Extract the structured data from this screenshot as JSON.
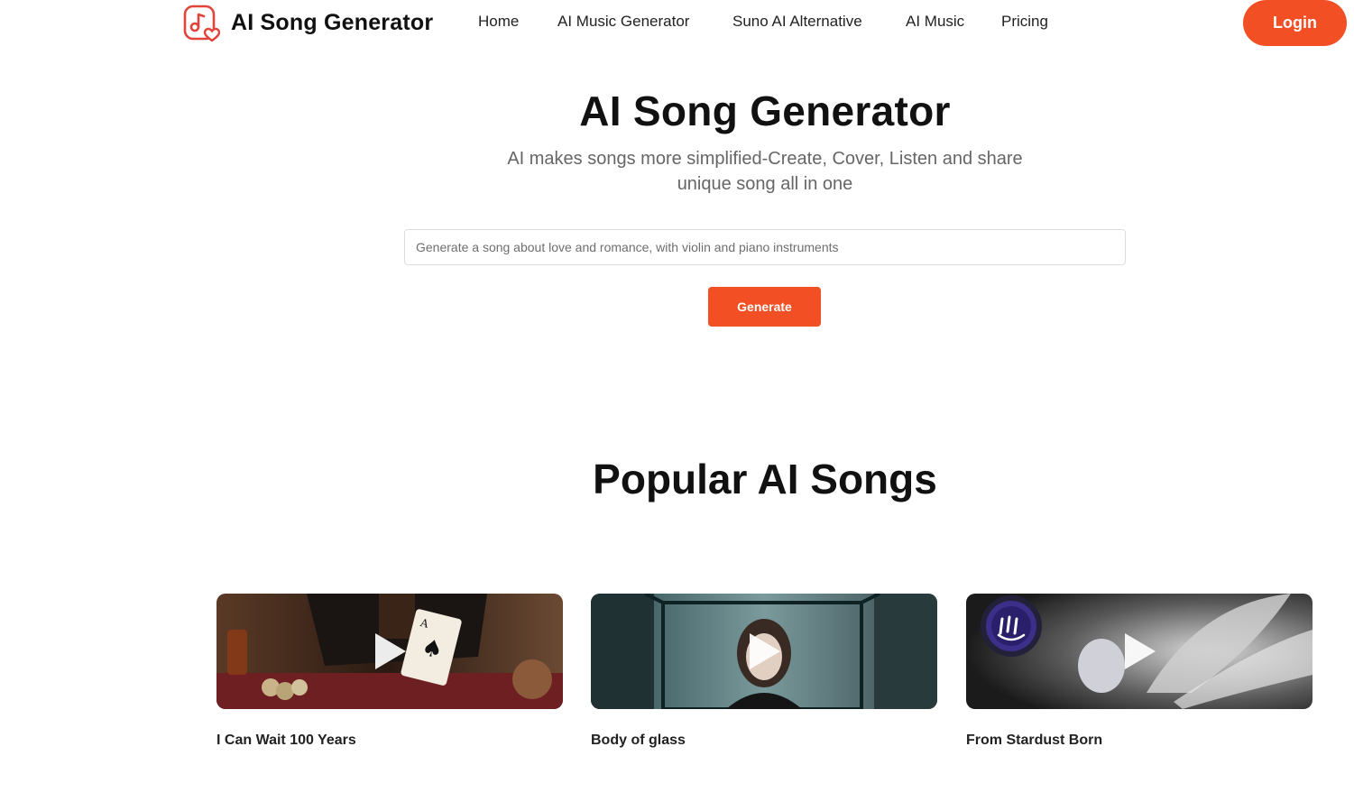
{
  "header": {
    "logo_text": "AI Song Generator",
    "logo_icon": "music-note-heart-icon",
    "nav": [
      "Home",
      "AI Music Generator",
      "Suno AI Alternative",
      "AI Music",
      "Pricing"
    ],
    "login_label": "Login"
  },
  "hero": {
    "title": "AI Song Generator",
    "subtitle": "AI makes songs more simplified-Create, Cover, Listen and share unique song all in one",
    "prompt_placeholder": "Generate a song about love and romance, with violin and piano instruments",
    "generate_label": "Generate"
  },
  "popular": {
    "title": "Popular AI Songs",
    "songs": [
      {
        "title": "I Can Wait 100 Years",
        "icon": "play-icon"
      },
      {
        "title": "Body of glass",
        "icon": "play-icon"
      },
      {
        "title": "From Stardust Born",
        "icon": "play-icon"
      }
    ]
  },
  "colors": {
    "accent": "#f34f24",
    "text": "#111111",
    "muted": "#666666"
  }
}
